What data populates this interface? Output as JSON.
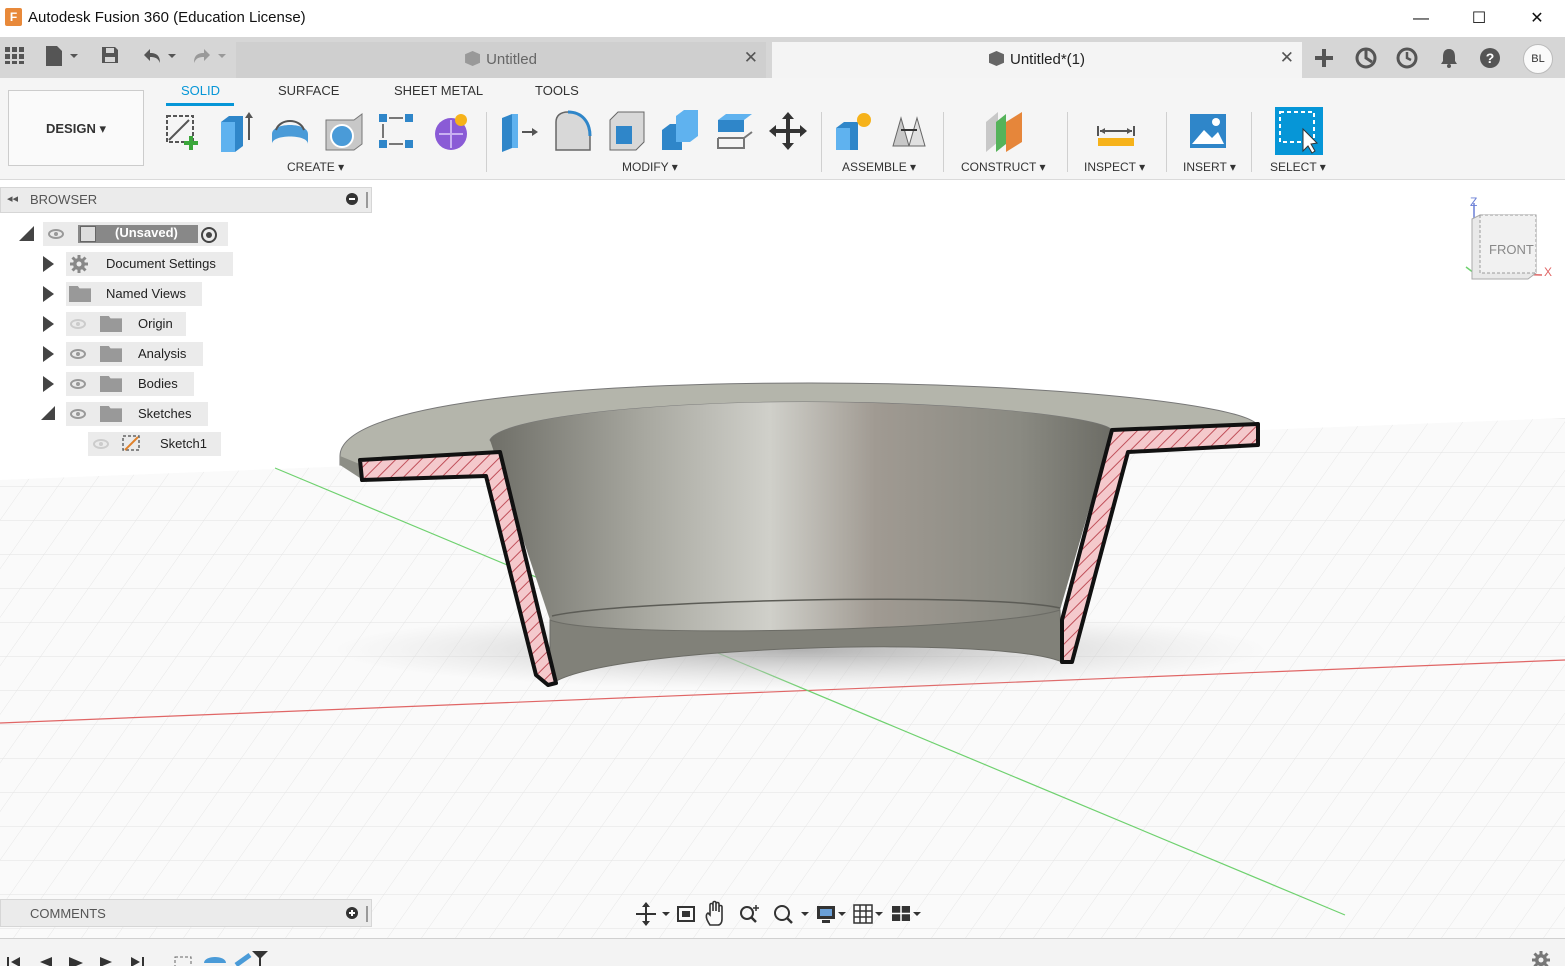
{
  "window": {
    "title": "Autodesk Fusion 360 (Education License)",
    "logo_letter": "F",
    "minimize_glyph": "—",
    "maximize_glyph": "☐",
    "close_glyph": "✕"
  },
  "tabs": [
    {
      "label": "Untitled",
      "active": false
    },
    {
      "label": "Untitled*(1)",
      "active": true
    }
  ],
  "tab_close_glyph": "✕",
  "user": {
    "initials": "BL"
  },
  "workspace": {
    "label": "DESIGN ▾"
  },
  "ribbon": {
    "tabs": [
      "SOLID",
      "SURFACE",
      "SHEET METAL",
      "TOOLS"
    ],
    "active_tab": "SOLID",
    "groups": {
      "create": "CREATE ▾",
      "modify": "MODIFY ▾",
      "assemble": "ASSEMBLE ▾",
      "construct": "CONSTRUCT ▾",
      "inspect": "INSPECT ▾",
      "insert": "INSERT ▾",
      "select": "SELECT ▾"
    }
  },
  "browser": {
    "title": "BROWSER",
    "root": "(Unsaved)",
    "items": [
      "Document Settings",
      "Named Views",
      "Origin",
      "Analysis",
      "Bodies",
      "Sketches"
    ],
    "sketches": [
      "Sketch1"
    ]
  },
  "comments": {
    "title": "COMMENTS"
  },
  "viewcube": {
    "face": "FRONT",
    "axis_z": "Z",
    "axis_x": "X"
  },
  "colors": {
    "accent": "#0696d7",
    "section_fill": "#f4c9cc",
    "section_hatch": "#c0505a",
    "model": "#8e8e86",
    "axis_x": "#e06666",
    "axis_y": "#6fd16f"
  }
}
